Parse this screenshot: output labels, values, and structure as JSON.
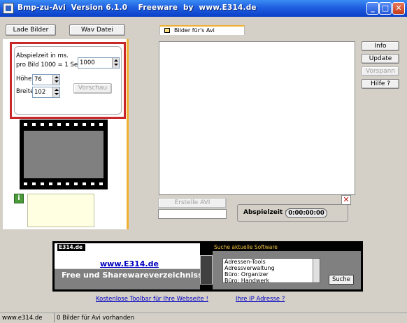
{
  "window": {
    "title": "Bmp-zu-Avi  Version 6.1.0    Freeware  by  www.E314.de"
  },
  "toolbar": {
    "load_images": "Lade Bilder",
    "wav_file": "Wav Datei"
  },
  "params": {
    "duration_label_1": "Abspielzeit in ms.",
    "duration_label_2": "pro Bild  1000 = 1 Sec.",
    "duration_value": "1000",
    "height_label": "Höhe",
    "height_value": "76",
    "width_label": "Breite",
    "width_value": "102",
    "preview_button": "Vorschau"
  },
  "center": {
    "tab_label": "Bilder für's Avi",
    "create_avi_button": "Erstelle AVI",
    "playtime_label": "Abspielzeit :",
    "playtime_value": "0:00:00:00"
  },
  "right_buttons": {
    "info": "Info",
    "update": "Update",
    "preview": "Vorspann",
    "help": "Hilfe ?"
  },
  "ad": {
    "brand": "E314.de",
    "url": "www.E314.de",
    "subtitle": "Free und Sharewareverzeichniss",
    "search_header": "Suche aktuelle Software",
    "categories": [
      "Adressen-Tools",
      "Adressverwaltung",
      "Büro: Organizer",
      "Büro: Handwerk"
    ],
    "search_button": "Suche"
  },
  "links": {
    "toolbar": "Kostenlose Toolbar für Ihre Webseite !",
    "ip": "Ihre IP Adresse ?"
  },
  "status": {
    "website": "www.e314.de",
    "message": "0 Bilder für Avi vorhanden"
  },
  "colors": {
    "title_bar": "#1f5fe0",
    "highlight_border": "#c8282a",
    "accent_orange": "#f0b030",
    "link": "#0000c0"
  }
}
